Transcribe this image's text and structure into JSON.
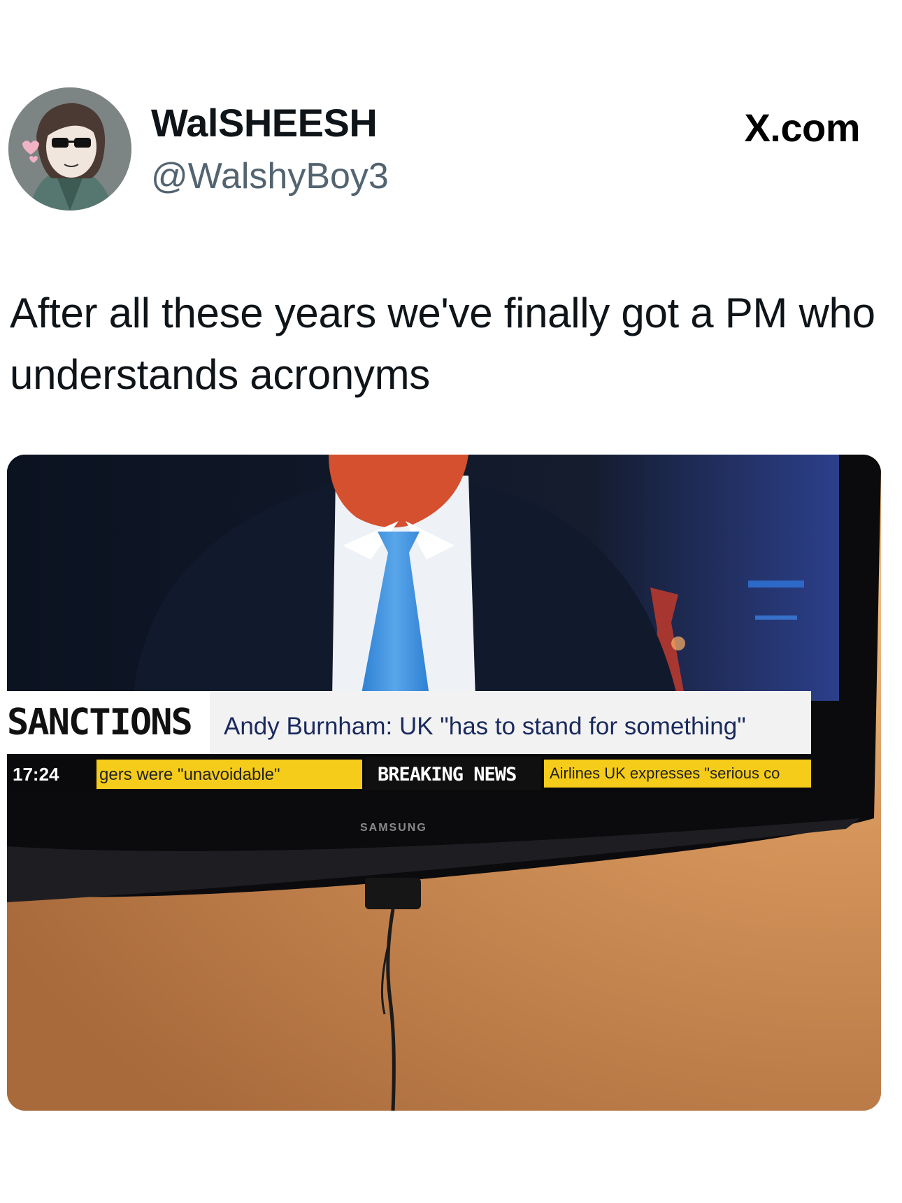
{
  "tweet": {
    "display_name": "WalSHEESH",
    "handle": "@WalshyBoy3",
    "source": "X.com",
    "text": "After all these years we've finally got a PM who understands acronyms"
  },
  "photo": {
    "tv_brand": "SAMSUNG",
    "chyron": {
      "section": "SANCTIONS",
      "headline": "Andy Burnham: UK \"has to stand for something\"",
      "time": "17:24",
      "ticker_left": "gers were \"unavoidable\"",
      "breaking_label": "BREAKING NEWS",
      "ticker_right": "Airlines UK expresses \"serious co"
    }
  }
}
